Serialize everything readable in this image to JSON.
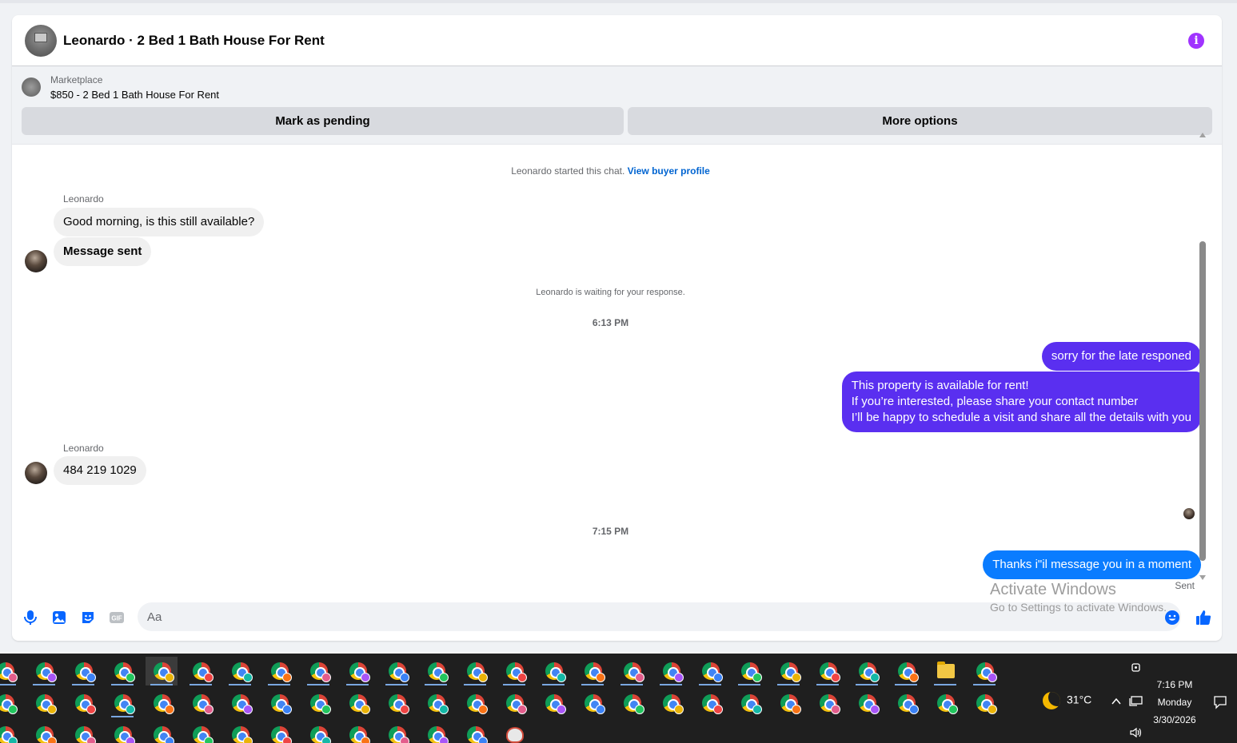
{
  "header": {
    "title": "Leonardo · 2 Bed 1 Bath House For Rent",
    "info_icon": "info-icon",
    "info_glyph": "i"
  },
  "listing": {
    "label": "Marketplace",
    "price_title": "$850 - 2 Bed 1 Bath House For Rent",
    "mark_pending_label": "Mark as pending",
    "more_options_label": "More options"
  },
  "conversation": {
    "started_text": "Leonardo started this chat.",
    "view_profile_link": "View buyer profile",
    "waiting_text": "Leonardo is waiting for your response.",
    "messages": [
      {
        "sender": "Leonardo",
        "direction": "incoming",
        "text": "Good morning, is this still available?"
      },
      {
        "sender": "Leonardo",
        "direction": "incoming",
        "text": "Message sent"
      },
      {
        "direction": "outgoing",
        "text": "sorry for the late responed"
      },
      {
        "direction": "outgoing",
        "lines": [
          "This property is available for rent!",
          "If you’re interested, please share your contact number",
          "I’ll be happy to schedule a visit and share all the details with you"
        ]
      },
      {
        "sender": "Leonardo",
        "direction": "incoming",
        "text": "484 219 1029"
      },
      {
        "direction": "outgoing",
        "text": "Thanks i\"il message you in a moment"
      }
    ],
    "time_dividers": [
      "6:13 PM",
      "7:15 PM"
    ],
    "sent_status": "Sent"
  },
  "composer": {
    "placeholder": "Aa",
    "gif_label": "GIF",
    "icons": [
      "microphone-icon",
      "photo-icon",
      "sticker-icon",
      "gif-icon",
      "emoji-icon",
      "thumbs-up-icon"
    ]
  },
  "watermark": {
    "line1": "Activate Windows",
    "line2": "Go to Settings to activate Windows."
  },
  "taskbar": {
    "weather": "31°C",
    "time": "7:16 PM",
    "day": "Monday",
    "date": "3/30/2026"
  },
  "colors": {
    "outgoing_purple": "#5a2ff0",
    "outgoing_blue": "#0a7cff",
    "accent_blue": "#0064d1",
    "info_purple": "#a033ff"
  }
}
